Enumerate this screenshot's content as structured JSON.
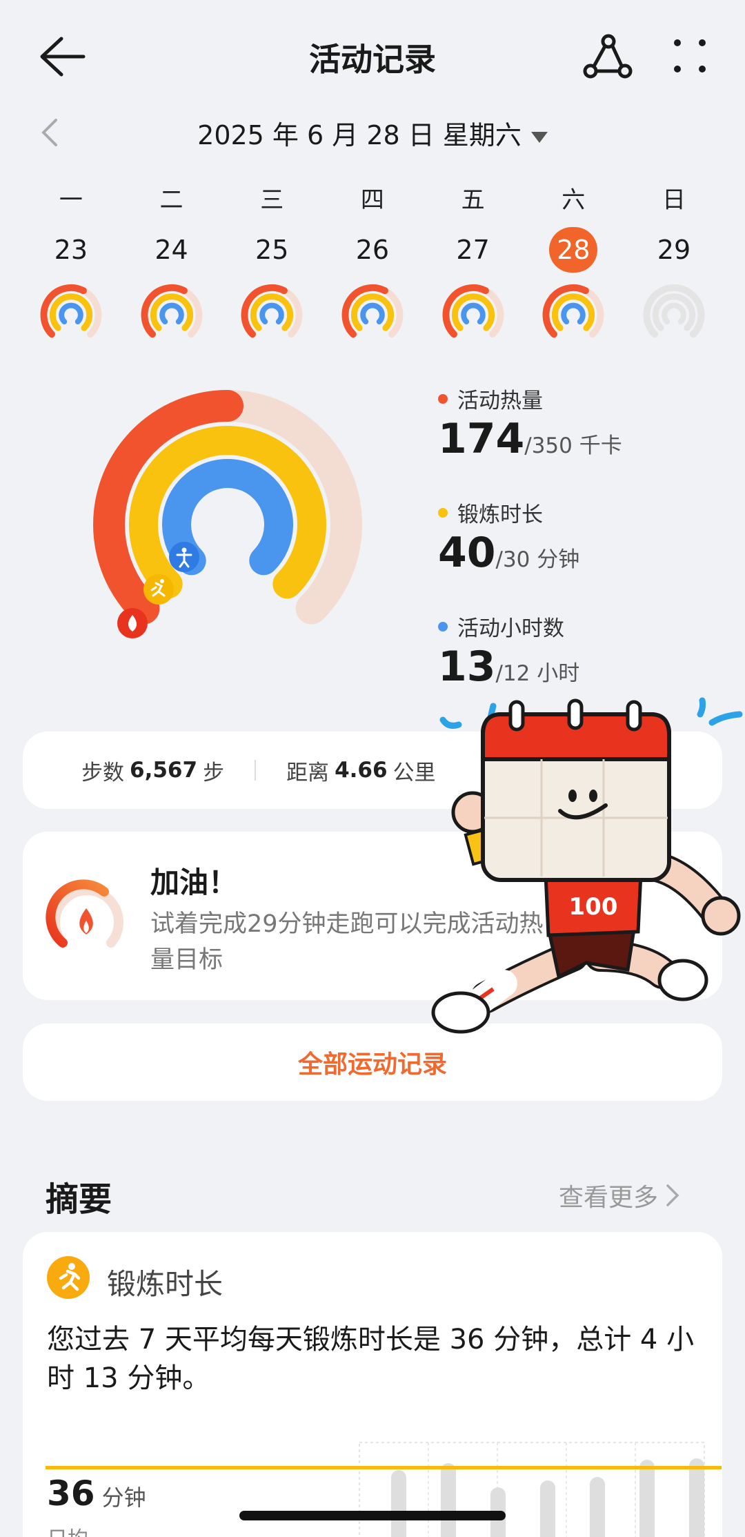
{
  "header": {
    "title": "活动记录"
  },
  "date_selector": {
    "label": "2025 年 6 月 28 日 星期六"
  },
  "week": [
    {
      "weekday": "一",
      "date": "23"
    },
    {
      "weekday": "二",
      "date": "24"
    },
    {
      "weekday": "三",
      "date": "25"
    },
    {
      "weekday": "四",
      "date": "26"
    },
    {
      "weekday": "五",
      "date": "27"
    },
    {
      "weekday": "六",
      "date": "28",
      "selected": true
    },
    {
      "weekday": "日",
      "date": "29",
      "future": true
    }
  ],
  "activity": {
    "calories": {
      "label": "活动热量",
      "value": "174",
      "goal": "/350 千卡",
      "color": "#f1532f",
      "progress": 0.5
    },
    "exercise": {
      "label": "锻炼时长",
      "value": "40",
      "goal": "/30 分钟",
      "color": "#f8c20f",
      "progress": 1.0
    },
    "stand": {
      "label": "活动小时数",
      "value": "13",
      "goal": "/12 小时",
      "color": "#4a96ee",
      "progress": 1.0
    }
  },
  "steps_card": {
    "steps_label": "步数",
    "steps_value": "6,567",
    "steps_unit": "步",
    "distance_label": "距离",
    "distance_value": "4.66",
    "distance_unit": "公里"
  },
  "cheer_card": {
    "title": "加油！",
    "text": "试着完成29分钟走跑可以完成活动热量目标"
  },
  "all_records": {
    "label": "全部运动记录"
  },
  "summary": {
    "title": "摘要",
    "more": "查看更多",
    "exercise_label": "锻炼时长",
    "description": "您过去 7 天平均每天锻炼时长是 36 分钟，总计 4 小时 13 分钟。",
    "avg_value": "36",
    "avg_unit": "分钟",
    "avg_sub": "日均"
  },
  "mascot": {
    "shirt_number": "100"
  },
  "colors": {
    "accent": "#f2652a",
    "calorie": "#f1532f",
    "exercise": "#f8c20f",
    "stand": "#4a96ee"
  }
}
